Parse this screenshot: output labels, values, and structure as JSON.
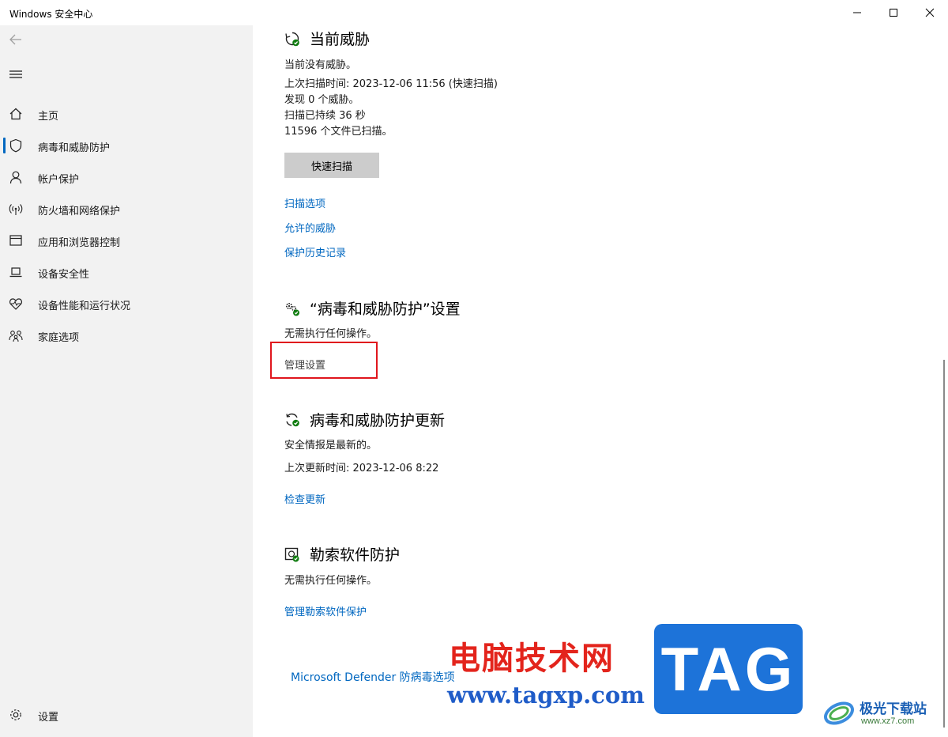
{
  "window": {
    "title": "Windows 安全中心",
    "controls": {
      "minimize": "minimize-icon",
      "maximize": "maximize-icon",
      "close": "close-icon"
    }
  },
  "sidebar": {
    "items": [
      {
        "label": "主页",
        "icon": "home-icon"
      },
      {
        "label": "病毒和威胁防护",
        "icon": "shield-icon",
        "active": true
      },
      {
        "label": "帐户保护",
        "icon": "person-icon"
      },
      {
        "label": "防火墙和网络保护",
        "icon": "wifi-signal-icon"
      },
      {
        "label": "应用和浏览器控制",
        "icon": "browser-window-icon"
      },
      {
        "label": "设备安全性",
        "icon": "laptop-icon"
      },
      {
        "label": "设备性能和运行状况",
        "icon": "heart-pulse-icon"
      },
      {
        "label": "家庭选项",
        "icon": "family-icon"
      }
    ],
    "settings_label": "设置"
  },
  "threats": {
    "title": "当前威胁",
    "status": "当前没有威胁。",
    "last_scan": "上次扫描时间: 2023-12-06 11:56 (快速扫描)",
    "found": "发现 0 个威胁。",
    "duration": "扫描已持续 36 秒",
    "files": "11596 个文件已扫描。",
    "quick_scan_button": "快速扫描",
    "links": [
      "扫描选项",
      "允许的威胁",
      "保护历史记录"
    ]
  },
  "settings": {
    "title": "“病毒和威胁防护”设置",
    "status": "无需执行任何操作。",
    "manage_link": "管理设置"
  },
  "updates": {
    "title": "病毒和威胁防护更新",
    "status": "安全情报是最新的。",
    "last_update": "上次更新时间: 2023-12-06 8:22",
    "check_link": "检查更新"
  },
  "ransomware": {
    "title": "勒索软件防护",
    "status": "无需执行任何操作。",
    "manage_link": "管理勒索软件保护"
  },
  "footer": {
    "defender_link": "Microsoft Defender 防病毒选项"
  },
  "watermark": {
    "cn_text": "电脑技术网",
    "url": "www.tagxp.com",
    "tag_text": "TAG",
    "logo_cn": "极光下载站",
    "logo_url": "www.xz7.com"
  },
  "colors": {
    "accent": "#0067c0",
    "sidebar_bg": "#f2f2f2",
    "highlight": "#e0161d",
    "ok_green": "#107c10"
  }
}
